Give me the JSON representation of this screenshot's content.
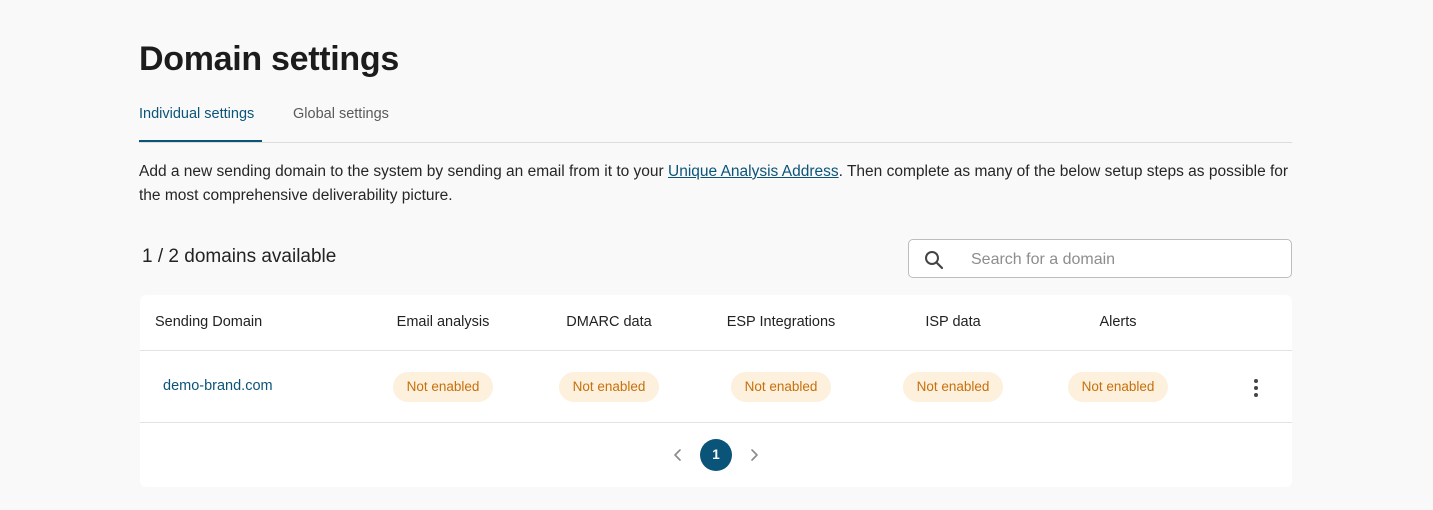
{
  "page": {
    "title": "Domain settings"
  },
  "tabs": [
    {
      "label": "Individual settings",
      "active": true
    },
    {
      "label": "Global settings",
      "active": false
    }
  ],
  "description": {
    "before_link": "Add a new sending domain to the system by sending an email from it to your ",
    "link": "Unique Analysis Address",
    "after_link": ". Then complete as many of the below setup steps as possible for the most comprehensive deliverability picture."
  },
  "domains_count": "1 / 2 domains available",
  "search": {
    "placeholder": "Search for a domain",
    "value": "",
    "icon": "search-icon"
  },
  "table": {
    "columns": [
      "Sending Domain",
      "Email analysis",
      "DMARC data",
      "ESP Integrations",
      "ISP data",
      "Alerts"
    ],
    "rows": [
      {
        "domain": "demo-brand.com",
        "email_analysis": "Not enabled",
        "dmarc_data": "Not enabled",
        "esp_integrations": "Not enabled",
        "isp_data": "Not enabled",
        "alerts": "Not enabled",
        "menu_icon": "more-vertical-icon"
      }
    ]
  },
  "pagination": {
    "current_page": "1",
    "prev_icon": "chevron-left-icon",
    "next_icon": "chevron-right-icon"
  },
  "colors": {
    "accent": "#0b5479",
    "badge_bg": "#fdf0dd",
    "badge_text": "#c7700c",
    "page_bg": "#f9f9f9"
  }
}
